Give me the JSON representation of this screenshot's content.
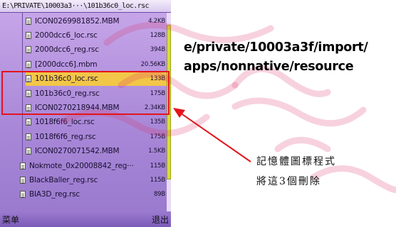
{
  "window": {
    "title": "E:\\PRIVATE\\10003a3···\\101b36c0_loc.rsc"
  },
  "files": [
    {
      "name": "ICON0269981852.MBM",
      "size": "4.2KB",
      "indent": 1,
      "selected": false,
      "highlighted": false
    },
    {
      "name": "2000dcc6_loc.rsc",
      "size": "128B",
      "indent": 1,
      "selected": false,
      "highlighted": false
    },
    {
      "name": "2000dcc6_reg.rsc",
      "size": "394B",
      "indent": 1,
      "selected": false,
      "highlighted": false
    },
    {
      "name": "[2000dcc6].mbm",
      "size": "20.56KB",
      "indent": 1,
      "selected": false,
      "highlighted": false
    },
    {
      "name": "101b36c0_loc.rsc",
      "size": "133B",
      "indent": 1,
      "selected": true,
      "highlighted": true
    },
    {
      "name": "101b36c0_reg.rsc",
      "size": "175B",
      "indent": 1,
      "selected": false,
      "highlighted": true
    },
    {
      "name": "ICON0270218944.MBM",
      "size": "2.34KB",
      "indent": 1,
      "selected": false,
      "highlighted": true
    },
    {
      "name": "1018f6f6_loc.rsc",
      "size": "135B",
      "indent": 1,
      "selected": false,
      "highlighted": false
    },
    {
      "name": "1018f6f6_reg.rsc",
      "size": "175B",
      "indent": 1,
      "selected": false,
      "highlighted": false
    },
    {
      "name": "ICON0270071542.MBM",
      "size": "1.5KB",
      "indent": 1,
      "selected": false,
      "highlighted": false
    },
    {
      "name": "Nokmote_0x20008842_reg···",
      "size": "115B",
      "indent": 0,
      "selected": false,
      "highlighted": false
    },
    {
      "name": "BlackBaller_reg.rsc",
      "size": "115B",
      "indent": 0,
      "selected": false,
      "highlighted": false
    },
    {
      "name": "BIA3D_reg.rsc",
      "size": "89B",
      "indent": 0,
      "selected": false,
      "highlighted": false
    }
  ],
  "scrollbar": {
    "position": 0.06,
    "visible_fraction": 0.78
  },
  "softkeys": {
    "left": "菜单",
    "right": "退出"
  },
  "annotation": {
    "path_line1": "e/private/10003a3f/import/",
    "path_line2": "apps/nonnative/resource",
    "note_line1": "記憶體圖標程式",
    "note_line2": "將這3個刪除"
  },
  "colors": {
    "highlight": "#e4141b",
    "selection": "#f2c648",
    "background": "#a988d8"
  }
}
